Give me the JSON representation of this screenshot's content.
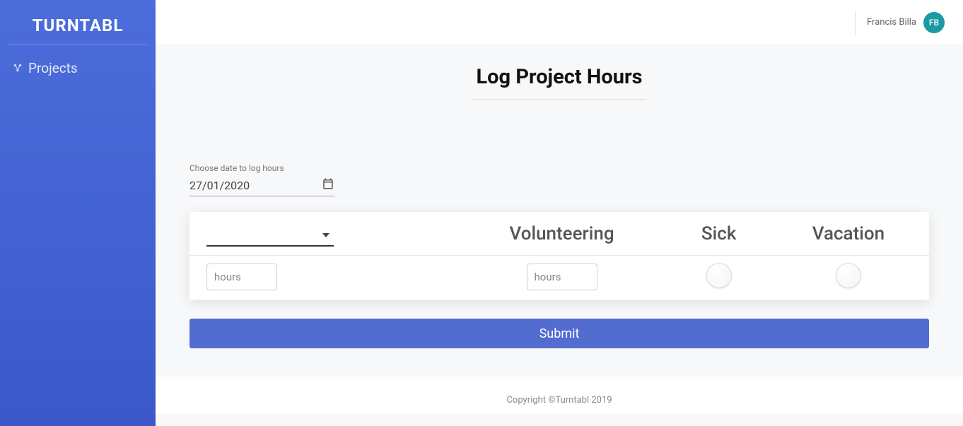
{
  "brand": "TURNTABL",
  "sidebar": {
    "items": [
      {
        "label": "Projects"
      }
    ]
  },
  "user": {
    "name": "Francis Billa",
    "initials": "FB"
  },
  "page": {
    "title": "Log Project Hours",
    "date_label": "Choose date to log hours",
    "date_value": "27/01/2020",
    "columns": {
      "project": "",
      "volunteering": "Volunteering",
      "sick": "Sick",
      "vacation": "Vacation"
    },
    "inputs": {
      "project_hours_placeholder": "hours",
      "volunteering_hours_placeholder": "hours"
    },
    "submit_label": "Submit"
  },
  "footer": "Copyright ©Turntabl 2019"
}
